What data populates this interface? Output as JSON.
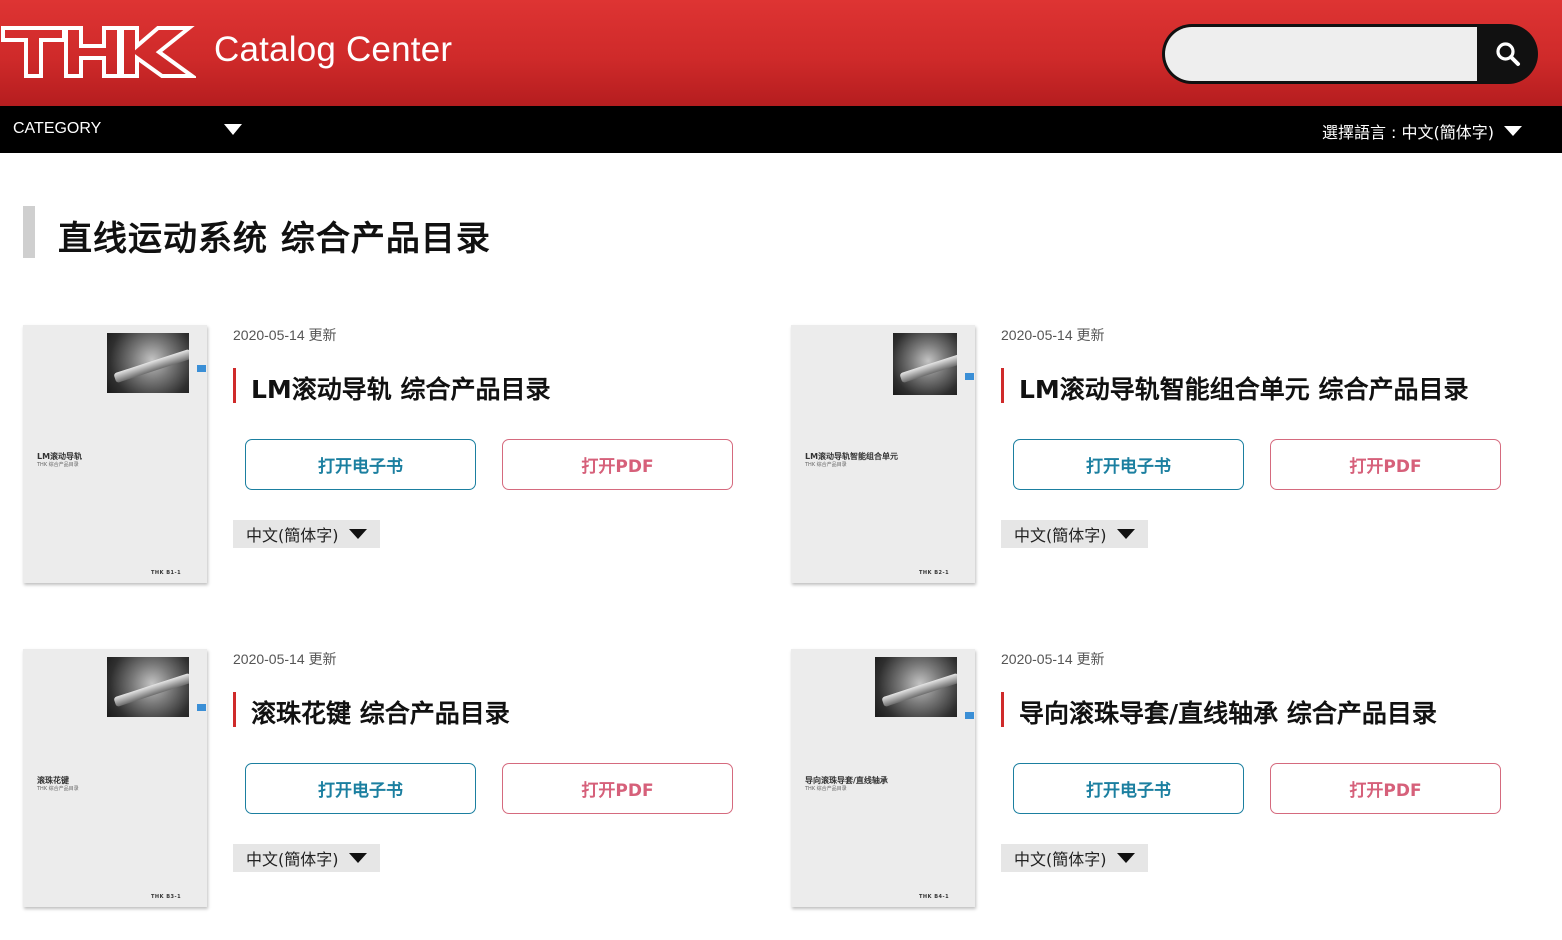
{
  "header": {
    "logo_text": "THK",
    "app_title": "Catalog Center",
    "search": {
      "value": "",
      "placeholder": ""
    },
    "search_icon": "search-icon"
  },
  "nav": {
    "category_label": "CATEGORY",
    "language_label": "選擇語言 : 中文(簡体字)"
  },
  "page": {
    "title": "直线运动系统 综合产品目录"
  },
  "catalogs": [
    {
      "date": "2020-05-14 更新",
      "title": "LM滚动导轨 综合产品目录",
      "ebook_label": "打开电子书",
      "pdf_label": "打开PDF",
      "language": "中文(簡体字)",
      "cover": {
        "title": "LM滚动导轨",
        "subtitle": "THK 综合产品目录",
        "footer": "THK  B1-1"
      }
    },
    {
      "date": "2020-05-14 更新",
      "title": "LM滚动导轨智能组合单元 综合产品目录",
      "ebook_label": "打开电子书",
      "pdf_label": "打开PDF",
      "language": "中文(簡体字)",
      "cover": {
        "title": "LM滚动导轨智能组合单元",
        "subtitle": "THK 综合产品目录",
        "footer": "THK  B2-1"
      }
    },
    {
      "date": "2020-05-14 更新",
      "title": "滚珠花键 综合产品目录",
      "ebook_label": "打开电子书",
      "pdf_label": "打开PDF",
      "language": "中文(簡体字)",
      "cover": {
        "title": "滚珠花键",
        "subtitle": "THK 综合产品目录",
        "footer": "THK  B3-1"
      }
    },
    {
      "date": "2020-05-14 更新",
      "title": "导向滚珠导套/直线轴承 综合产品目录",
      "ebook_label": "打开电子书",
      "pdf_label": "打开PDF",
      "language": "中文(簡体字)",
      "cover": {
        "title": "导向滚珠导套/直线轴承",
        "subtitle": "THK 综合产品目录",
        "footer": "THK  B4-1"
      }
    }
  ],
  "colors": {
    "header_red": "#d62f2f",
    "nav_black": "#000000",
    "ebook_blue": "#1b7fa0",
    "pdf_pink": "#d6607a",
    "title_accent": "#cf2a2a"
  }
}
